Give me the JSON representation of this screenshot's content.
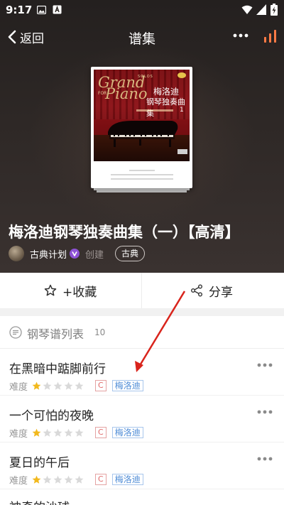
{
  "status_bar": {
    "time": "9:17",
    "icons": [
      "image-icon",
      "a-icon",
      "wifi-icon",
      "signal-icon",
      "battery-charging-icon"
    ]
  },
  "top_bar": {
    "back_label": "返回",
    "title": "谱集",
    "icons": [
      "chevron-left-icon",
      "more-dots-icon",
      "chart-bars-icon"
    ]
  },
  "cover": {
    "word_grand": "Grand",
    "word_solos": "SOLOS",
    "word_for": "FOR",
    "word_piano": "Piano",
    "cn_line1": "梅洛迪",
    "cn_line2": "钢琴独奏曲集",
    "number": "1"
  },
  "album": {
    "title": "梅洛迪钢琴独奏曲集（一）【高清】",
    "creator_name": "古典计划",
    "created_label": "创建",
    "tag": "古典"
  },
  "actions": {
    "favorite_label": "+收藏",
    "share_label": "分享"
  },
  "list": {
    "title": "钢琴谱列表",
    "count": "10",
    "difficulty_label": "难度",
    "songs": [
      {
        "title": "在黑暗中踮脚前行",
        "stars": 1,
        "max_stars": 5,
        "key": "C",
        "composer": "梅洛迪"
      },
      {
        "title": "一个可怕的夜晚",
        "stars": 1,
        "max_stars": 5,
        "key": "C",
        "composer": "梅洛迪"
      },
      {
        "title": "夏日的午后",
        "stars": 1,
        "max_stars": 5,
        "key": "C",
        "composer": "梅洛迪"
      },
      {
        "title": "神奇的沙球"
      }
    ]
  },
  "colors": {
    "header_bg": "#2e2826",
    "star_filled": "#f2b91e",
    "star_empty": "#d9d9d9",
    "key_badge": "#e06a6a",
    "composer_badge": "#4d8bd6",
    "annotation_arrow": "#d9241c"
  }
}
